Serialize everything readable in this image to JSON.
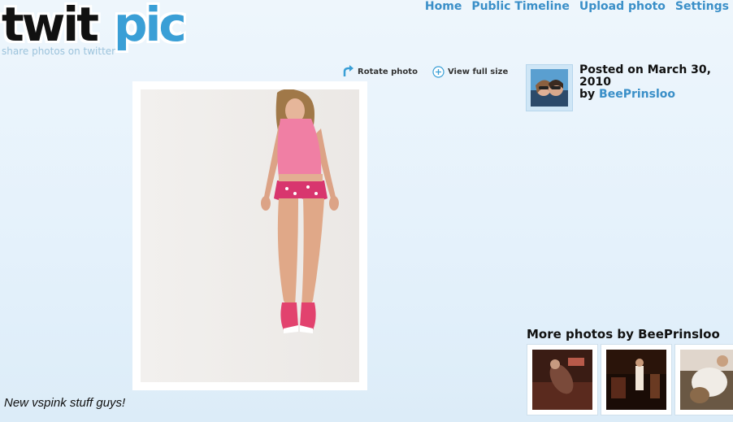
{
  "logo": {
    "word_dark": "twit",
    "word_accent": "pic",
    "tagline": "share photos on twitter",
    "colors": {
      "dark": "#111111",
      "accent": "#3a9fd6"
    }
  },
  "nav": {
    "items": [
      {
        "label": "Home"
      },
      {
        "label": "Public Timeline"
      },
      {
        "label": "Upload photo"
      },
      {
        "label": "Settings"
      }
    ]
  },
  "tools": {
    "rotate_label": "Rotate photo",
    "rotate_icon": "rotate-arrow-icon",
    "fullsize_label": "View full size",
    "fullsize_icon": "plus-circle-icon"
  },
  "photo": {
    "caption": "New vspink stuff guys!"
  },
  "sidebar": {
    "posted_prefix": "Posted on March 30, 2010",
    "by_prefix": "by ",
    "username": "BeePrinsloo",
    "more_title": "More photos by BeePrinsloo"
  },
  "colors": {
    "link": "#3a8fc8",
    "background": "#e4f1fb"
  }
}
